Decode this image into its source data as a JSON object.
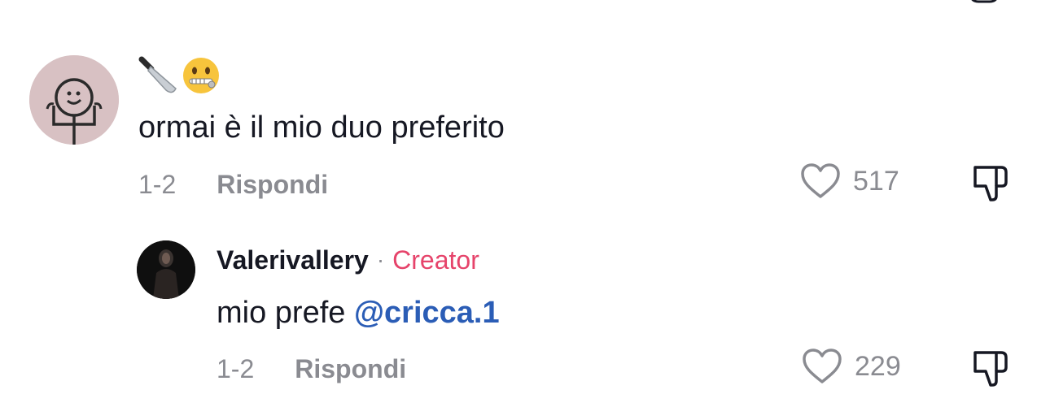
{
  "comment": {
    "emoji_icons": [
      "knife-icon",
      "zipper-mouth-face-icon"
    ],
    "text": "ormai è il mio duo preferito",
    "date": "1-2",
    "reply_label": "Rispondi",
    "like_count": "517"
  },
  "reply": {
    "username": "Valerivallery",
    "separator": "·",
    "badge": "Creator",
    "text_prefix": "mio prefe ",
    "mention": "@cricca.1",
    "date": "1-2",
    "reply_label": "Rispondi",
    "like_count": "229"
  },
  "colors": {
    "text": "#161823",
    "secondary": "#8a8b91",
    "creator_badge": "#e6446b",
    "mention": "#2b5db6"
  }
}
